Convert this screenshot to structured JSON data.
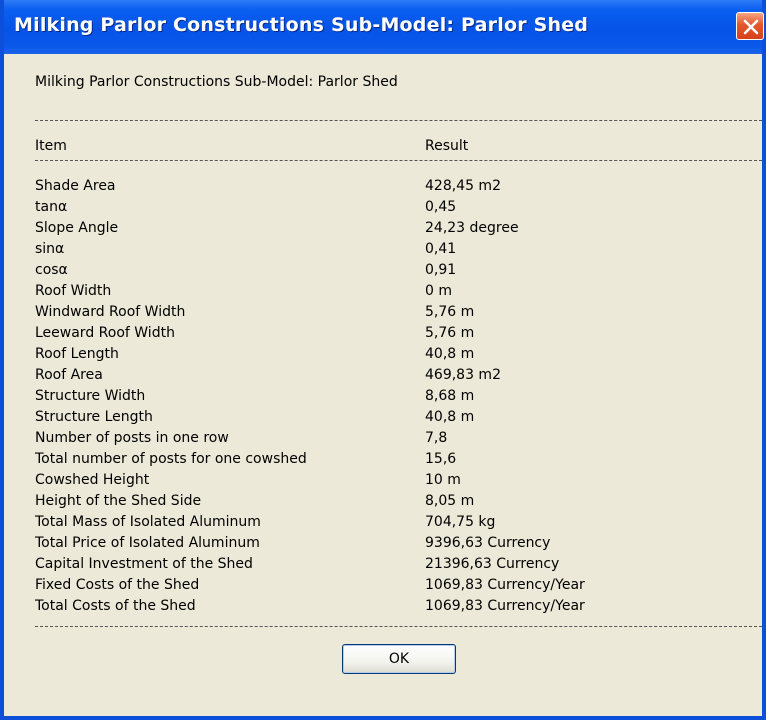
{
  "window": {
    "title": "Milking Parlor Constructions Sub-Model: Parlor Shed",
    "close_icon": "close-icon"
  },
  "report": {
    "heading": "Milking Parlor Constructions Sub-Model: Parlor Shed",
    "columns": {
      "item": "Item",
      "result": "Result"
    },
    "rows": [
      {
        "item": "Shade Area",
        "result": "428,45 m2"
      },
      {
        "item": "tanα",
        "result": "0,45"
      },
      {
        "item": "Slope Angle",
        "result": "24,23 degree"
      },
      {
        "item": "sinα",
        "result": "0,41"
      },
      {
        "item": "cosα",
        "result": "0,91"
      },
      {
        "item": "Roof Width",
        "result": "0 m"
      },
      {
        "item": "Windward Roof Width",
        "result": "5,76 m"
      },
      {
        "item": "Leeward Roof Width",
        "result": "5,76 m"
      },
      {
        "item": "Roof Length",
        "result": "40,8 m"
      },
      {
        "item": "Roof Area",
        "result": "469,83 m2"
      },
      {
        "item": "Structure Width",
        "result": "8,68 m"
      },
      {
        "item": "Structure Length",
        "result": "40,8 m"
      },
      {
        "item": "Number of posts in one row",
        "result": "7,8"
      },
      {
        "item": "Total number of posts for one cowshed",
        "result": "15,6"
      },
      {
        "item": "Cowshed Height",
        "result": "10 m"
      },
      {
        "item": "Height of the Shed Side",
        "result": "8,05 m"
      },
      {
        "item": "Total Mass of Isolated Aluminum",
        "result": "704,75 kg"
      },
      {
        "item": "Total Price of Isolated Aluminum",
        "result": "9396,63 Currency"
      },
      {
        "item": "Capital Investment of the Shed",
        "result": "21396,63 Currency"
      },
      {
        "item": "Fixed Costs of the Shed",
        "result": "1069,83 Currency/Year"
      },
      {
        "item": "Total Costs of the Shed",
        "result": "1069,83 Currency/Year"
      }
    ]
  },
  "buttons": {
    "ok_label": "OK"
  },
  "colors": {
    "titlebar": "#0a58e6",
    "client_bg": "#ece9d8",
    "close_button": "#e5572c"
  }
}
